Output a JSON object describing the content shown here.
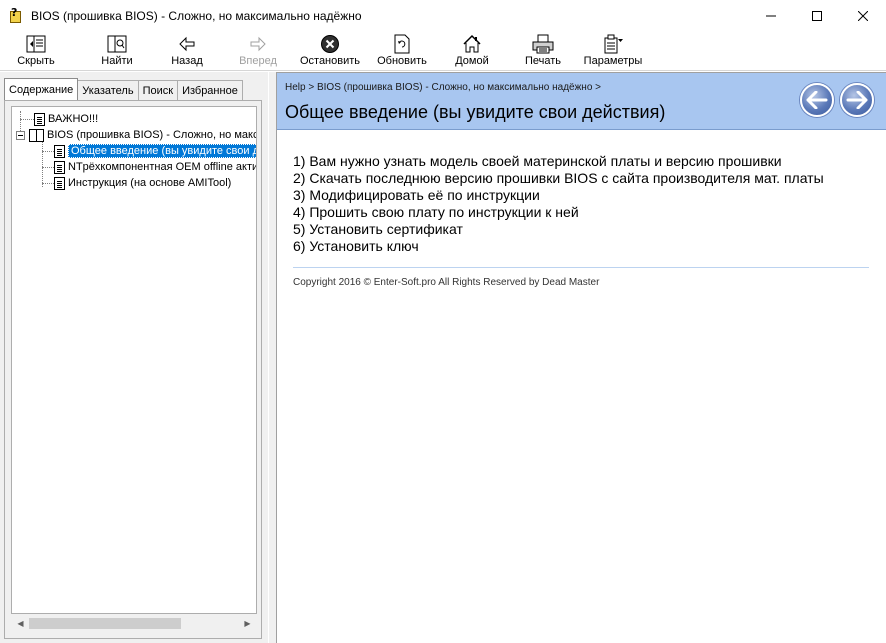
{
  "window": {
    "title": "BIOS (прошивка BIOS) - Сложно, но максимально надёжно",
    "controls": {
      "minimize": "—",
      "maximize": "☐",
      "close": "✕"
    }
  },
  "toolbar": {
    "hide": "Скрыть",
    "find": "Найти",
    "back": "Назад",
    "forward": "Вперед",
    "stop": "Остановить",
    "refresh": "Обновить",
    "home": "Домой",
    "print": "Печать",
    "options": "Параметры"
  },
  "tabs": [
    {
      "label": "Содержание",
      "active": true
    },
    {
      "label": "Указатель",
      "active": false
    },
    {
      "label": "Поиск",
      "active": false
    },
    {
      "label": "Избранное",
      "active": false
    }
  ],
  "tree": {
    "items": [
      {
        "label": "ВАЖНО!!!",
        "icon": "doc-icon"
      },
      {
        "label": "BIOS (прошивка BIOS) - Сложно, но максимально надёжно",
        "icon": "book-open-icon"
      },
      {
        "label": "Общее введение (вы увидите свои действия)",
        "icon": "doc-icon",
        "selected": true
      },
      {
        "label": "NTрёхкомпонентная OEM offline активация",
        "icon": "doc-icon"
      },
      {
        "label": "Инструкция (на основе AMITool)",
        "icon": "doc-icon"
      }
    ]
  },
  "content": {
    "breadcrumb": "Help > BIOS (прошивка BIOS) - Сложно, но максимально надёжно >",
    "title": "Общее введение (вы увидите свои действия)",
    "steps": [
      "1) Вам нужно узнать модель своей материнской платы и версию прошивки",
      "2) Скачать последнюю версию прошивки BIOS с сайта производителя мат. платы",
      "3) Модифицировать её по инструкции",
      "4) Прошить свою плату по инструкции к ней",
      "5) Установить сертификат",
      "6) Установить ключ"
    ],
    "copyright": "Copyright 2016 © Enter-Soft.pro All Rights Reserved by Dead Master"
  },
  "colors": {
    "header_bg": "#a8c6f0",
    "selection": "#0078d7",
    "nav_button": "#5b79b8"
  }
}
